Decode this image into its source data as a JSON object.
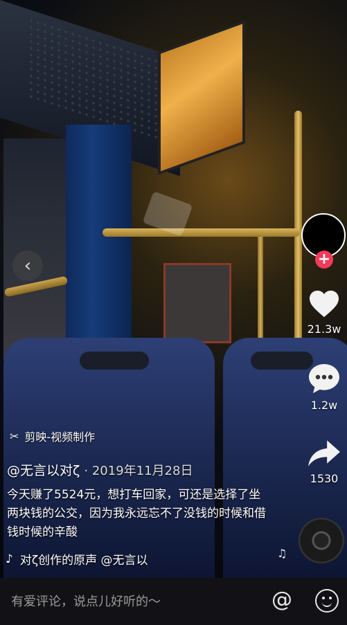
{
  "editor_tag": {
    "icon": "capcut-icon",
    "label": "剪映-视频制作"
  },
  "post": {
    "author": "@无言以对ζ",
    "date": "· 2019年11月28日",
    "caption": "今天赚了5524元，想打车回家，可还是选择了坐两块钱的公交，因为我永远忘不了没钱的时候和借钱时候的辛酸",
    "music": "对ζ创作的原声    @无言以"
  },
  "actions": {
    "likes": "21.3w",
    "comments": "1.2w",
    "shares": "1530"
  },
  "comment_bar": {
    "placeholder": "有爱评论，说点儿好听的～",
    "at_symbol": "@"
  },
  "colors": {
    "follow_badge": "#f33a5a",
    "bottom_bar": "#121216"
  }
}
